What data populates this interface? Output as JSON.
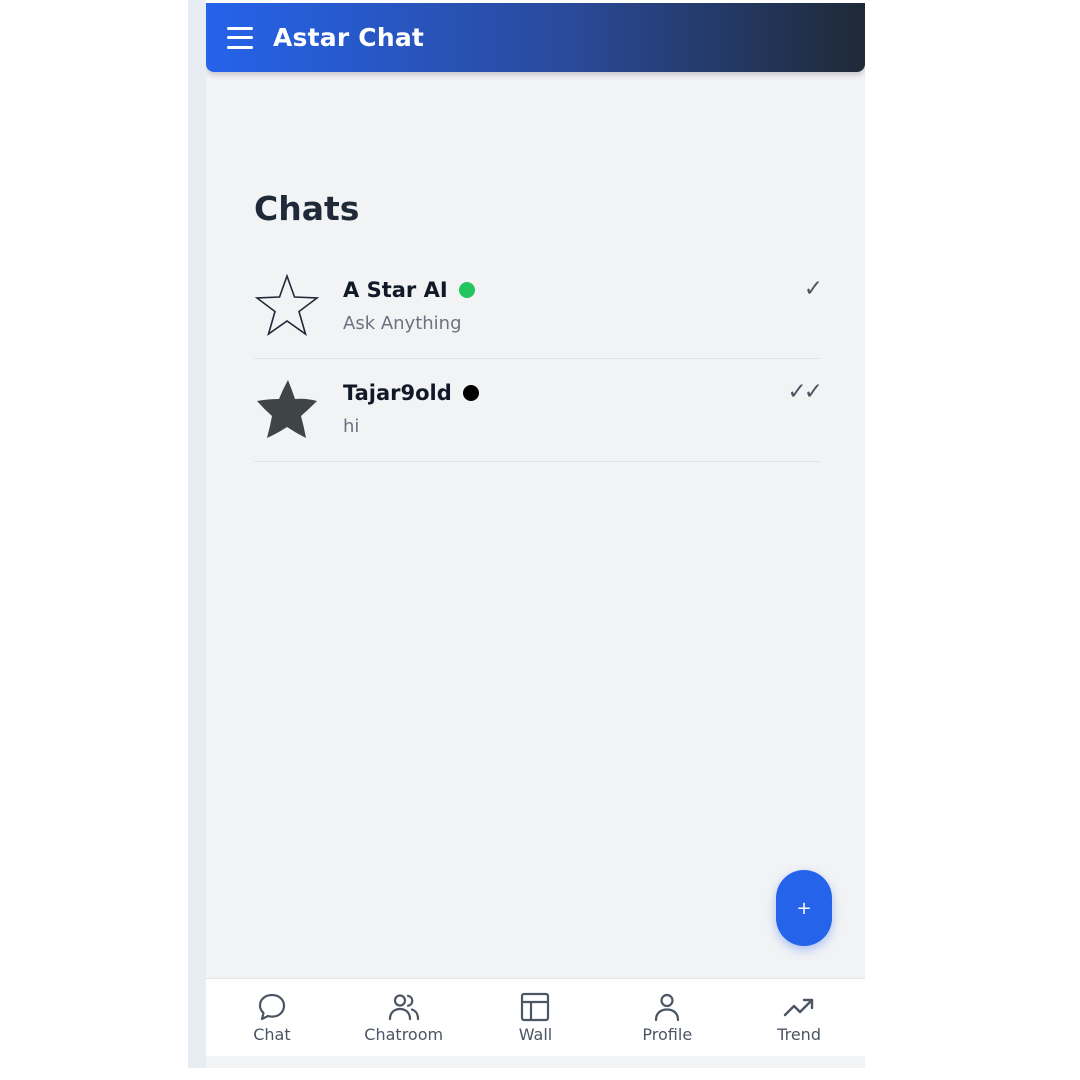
{
  "app_bar": {
    "title": "Astar Chat"
  },
  "section": {
    "title": "Chats"
  },
  "chats": [
    {
      "name": "A Star AI",
      "preview": "Ask Anything",
      "status_color": "#22c55e",
      "avatar_icon": "star-outline-icon",
      "read_mark": "✓"
    },
    {
      "name": "Tajar9old",
      "preview": "hi",
      "status_color": "#000000",
      "avatar_icon": "star-filled-icon",
      "read_mark": "✓✓"
    }
  ],
  "fab": {
    "label": "+"
  },
  "bottom_nav": {
    "items": [
      {
        "label": "Chat",
        "icon": "chat-bubble-icon"
      },
      {
        "label": "Chatroom",
        "icon": "users-icon"
      },
      {
        "label": "Wall",
        "icon": "layout-icon"
      },
      {
        "label": "Profile",
        "icon": "user-icon"
      },
      {
        "label": "Trend",
        "icon": "trending-up-icon"
      }
    ]
  },
  "colors": {
    "primary": "#2563eb",
    "header_end": "#1f2937",
    "background": "#f2f3f5"
  }
}
